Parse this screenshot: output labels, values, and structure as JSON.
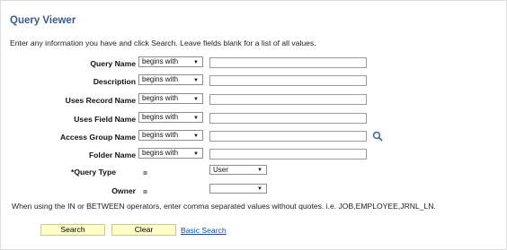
{
  "page": {
    "title": "Query Viewer",
    "instructions": "Enter any information you have and click Search. Leave fields blank for a list of all values."
  },
  "fields": [
    {
      "label": "Query Name",
      "operator": "begins with",
      "value": ""
    },
    {
      "label": "Description",
      "operator": "begins with",
      "value": ""
    },
    {
      "label": "Uses Record Name",
      "operator": "begins with",
      "value": ""
    },
    {
      "label": "Uses Field Name",
      "operator": "begins with",
      "value": ""
    },
    {
      "label": "Access Group Name",
      "operator": "begins with",
      "value": ""
    },
    {
      "label": "Folder Name",
      "operator": "begins with",
      "value": ""
    }
  ],
  "query_type": {
    "label": "*Query Type",
    "operator": "=",
    "value": "User"
  },
  "owner": {
    "label": "Owner",
    "operator": "=",
    "value": ""
  },
  "note": "When using the IN or BETWEEN operators, enter comma separated values without quotes. i.e. JOB,EMPLOYEE,JRNL_LN.",
  "buttons": {
    "search": "Search",
    "clear": "Clear",
    "basic_search": "Basic Search"
  },
  "icons": {
    "dropdown": "chevron-down-icon",
    "lookup": "magnifier-icon"
  },
  "colors": {
    "title": "#3a5a88",
    "button_bg": "#ffffc8",
    "link": "#1a4aa6"
  }
}
